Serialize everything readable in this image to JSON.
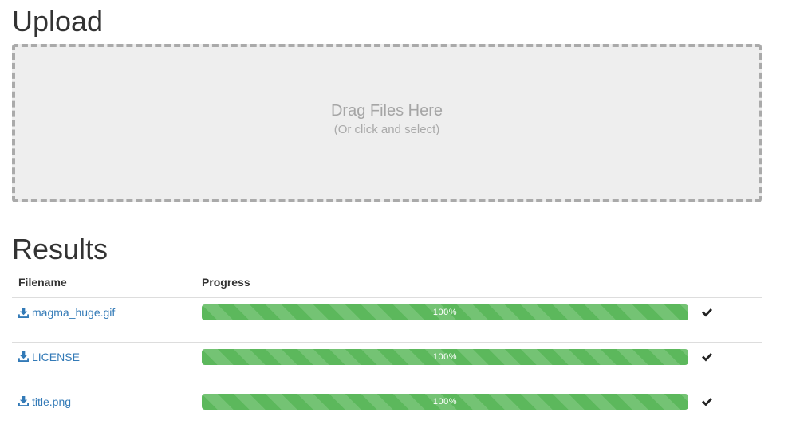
{
  "upload": {
    "title": "Upload",
    "dropzone": {
      "title": "Drag Files Here",
      "subtitle": "(Or click and select)"
    }
  },
  "results": {
    "title": "Results",
    "columns": {
      "filename": "Filename",
      "progress": "Progress"
    },
    "rows": [
      {
        "filename": "magma_huge.gif",
        "progress_label": "100%",
        "progress": 1.0,
        "status_icon": "check-icon"
      },
      {
        "filename": "LICENSE",
        "progress_label": "100%",
        "progress": 1.0,
        "status_icon": "check-icon"
      },
      {
        "filename": "title.png",
        "progress_label": "100%",
        "progress": 1.0,
        "status_icon": "check-icon"
      }
    ]
  },
  "colors": {
    "link": "#337ab7",
    "progress": "#5cb85c",
    "dropzone_bg": "#eeeeee",
    "dropzone_border": "#aaaaaa"
  }
}
